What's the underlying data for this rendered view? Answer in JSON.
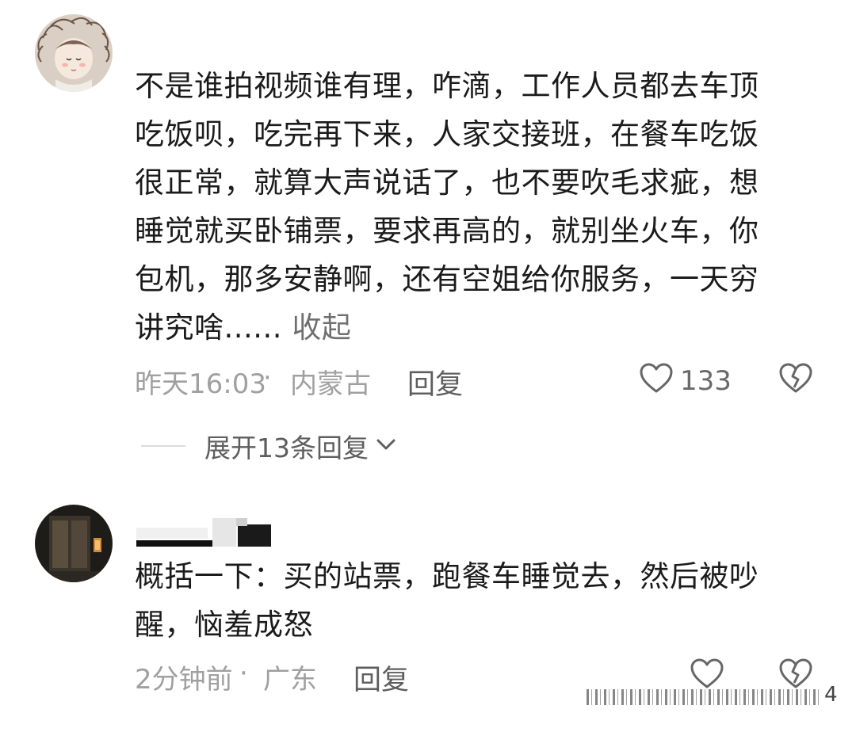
{
  "comments": [
    {
      "avatar_icon": "cartoon-girl-avatar",
      "username": "",
      "text_lines": [
        "不是谁拍视频谁有理，咋滴，工作人员都去车顶",
        "吃饭呗，吃完再下来，人家交接班，在餐车吃饭",
        "很正常，就算大声说话了，也不要吹毛求疵，想",
        "睡觉就买卧铺票，要求再高的，就别坐火车，你",
        "包机，那多安静啊，还有空姐给你服务，一天穷",
        "讲究啥......"
      ],
      "collapse_label": "收起",
      "time": "昨天16:03",
      "separator": "·",
      "location": "内蒙古",
      "reply_label": "回复",
      "like_count": "133",
      "expand_replies_label": "展开13条回复"
    },
    {
      "avatar_icon": "dark-doorway-avatar",
      "username": "",
      "text_lines": [
        "概括一下：买的站票，跑餐车睡觉去，然后被吵",
        "醒，恼羞成怒"
      ],
      "time": "2分钟前",
      "separator": "·",
      "location": "广东",
      "reply_label": "回复",
      "like_count": "",
      "trailing_mark": "4"
    }
  ],
  "colors": {
    "text": "#1b1b1b",
    "meta": "#a0a0a0",
    "action": "#5e5e5e",
    "icon_stroke": "#666666"
  }
}
